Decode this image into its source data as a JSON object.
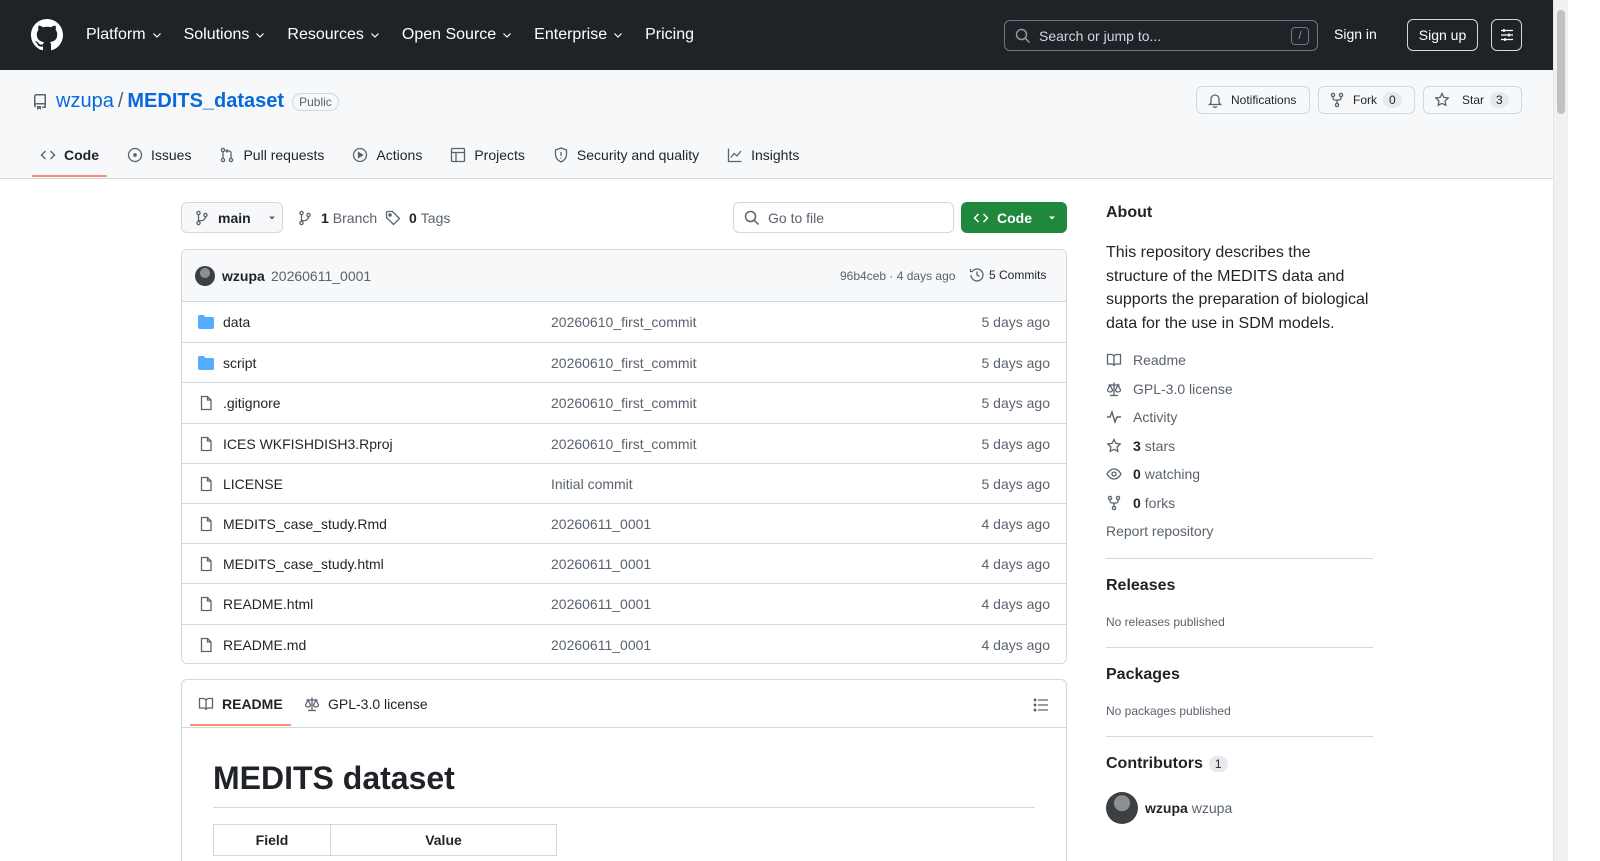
{
  "header": {
    "nav": [
      {
        "label": "Platform",
        "has_menu": true
      },
      {
        "label": "Solutions",
        "has_menu": true
      },
      {
        "label": "Resources",
        "has_menu": true
      },
      {
        "label": "Open Source",
        "has_menu": true
      },
      {
        "label": "Enterprise",
        "has_menu": true
      },
      {
        "label": "Pricing",
        "has_menu": false
      }
    ],
    "search_placeholder": "Search or jump to...",
    "search_kbd": "/",
    "signin": "Sign in",
    "signup": "Sign up"
  },
  "repo": {
    "owner": "wzupa",
    "slash": "/",
    "name": "MEDITS_dataset",
    "visibility": "Public",
    "notifications_label": "Notifications",
    "fork_label": "Fork",
    "fork_count": "0",
    "star_label": "Star",
    "star_count": "3",
    "tabs": [
      {
        "label": "Code",
        "icon": "code-icon",
        "active": true
      },
      {
        "label": "Issues",
        "icon": "issue-icon"
      },
      {
        "label": "Pull requests",
        "icon": "pull-request-icon"
      },
      {
        "label": "Actions",
        "icon": "play-icon"
      },
      {
        "label": "Projects",
        "icon": "table-icon"
      },
      {
        "label": "Security and quality",
        "icon": "shield-icon"
      },
      {
        "label": "Insights",
        "icon": "graph-icon"
      }
    ]
  },
  "toolbar": {
    "branch": "main",
    "branch_count": "1",
    "branch_word": "Branch",
    "tag_count": "0",
    "tag_word": "Tags",
    "goto_placeholder": "Go to file",
    "code_label": "Code"
  },
  "commit": {
    "author": "wzupa",
    "message": "20260611_0001",
    "hash_and_time": "96b4ceb · 4 days ago",
    "commits_label": "5 Commits"
  },
  "files": [
    {
      "name": "data",
      "type": "folder",
      "commit": "20260610_first_commit",
      "date": "5 days ago"
    },
    {
      "name": "script",
      "type": "folder",
      "commit": "20260610_first_commit",
      "date": "5 days ago"
    },
    {
      "name": ".gitignore",
      "type": "file",
      "commit": "20260610_first_commit",
      "date": "5 days ago"
    },
    {
      "name": "ICES WKFISHDISH3.Rproj",
      "type": "file",
      "commit": "20260610_first_commit",
      "date": "5 days ago"
    },
    {
      "name": "LICENSE",
      "type": "file",
      "commit": "Initial commit",
      "date": "5 days ago"
    },
    {
      "name": "MEDITS_case_study.Rmd",
      "type": "file",
      "commit": "20260611_0001",
      "date": "4 days ago"
    },
    {
      "name": "MEDITS_case_study.html",
      "type": "file",
      "commit": "20260611_0001",
      "date": "4 days ago"
    },
    {
      "name": "README.html",
      "type": "file",
      "commit": "20260611_0001",
      "date": "4 days ago"
    },
    {
      "name": "README.md",
      "type": "file",
      "commit": "20260611_0001",
      "date": "4 days ago"
    }
  ],
  "readme": {
    "tab_readme": "README",
    "tab_license": "GPL-3.0 license",
    "title": "MEDITS dataset",
    "table_headers": [
      "Field",
      "Value"
    ]
  },
  "sidebar": {
    "about_title": "About",
    "about_text": "This repository describes the structure of the MEDITS data and supports the preparation of biological data for the use in SDM models.",
    "readme": "Readme",
    "license": "GPL-3.0 license",
    "activity": "Activity",
    "stars_count": "3",
    "stars_word": "stars",
    "watching_count": "0",
    "watching_word": "watching",
    "forks_count": "0",
    "forks_word": "forks",
    "report": "Report repository",
    "releases_title": "Releases",
    "releases_text": "No releases published",
    "packages_title": "Packages",
    "packages_text": "No packages published",
    "contributors_title": "Contributors",
    "contributors_count": "1",
    "contributor_login": "wzupa",
    "contributor_name": "wzupa"
  },
  "colors": {
    "header_bg": "#1f2328",
    "link": "#0969da",
    "primary_button": "#1f883d",
    "active_tab_underline": "#fd8c73",
    "folder_icon": "#54aeff"
  }
}
